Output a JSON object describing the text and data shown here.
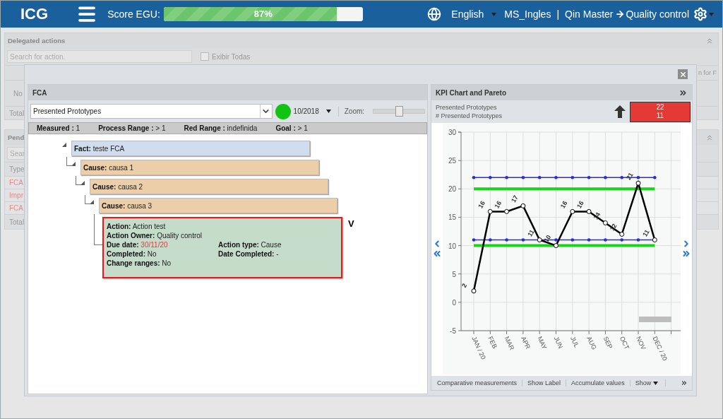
{
  "topbar": {
    "logo": "ICG",
    "score_label": "Score EGU:",
    "score": {
      "level": 0.87,
      "text": "87%"
    },
    "language": "English",
    "user": "MS_Ingles",
    "separator": "|",
    "path_from": "Qin Master",
    "path_to": "Quality control"
  },
  "background": {
    "delegated": {
      "title": "Delegated actions",
      "search_placeholder": "Search for action.",
      "checkbox": {
        "label": "Exibir Todas",
        "checked": false
      },
      "header_fragment": "n for F",
      "empty_fragment": "No",
      "total_fragment": "Total"
    },
    "pending": {
      "title": "Pend",
      "search_placeholder": "Sear",
      "header_fragment": "Type",
      "rows": [
        "FCA",
        "Impr",
        "FCA"
      ],
      "total_fragment": "Total"
    }
  },
  "fca": {
    "title": "FCA",
    "indicator": "Presented Prototypes",
    "period": "10/2018",
    "zoom_label": "Zoom:",
    "zoom": {
      "level": 0.5
    },
    "stats": [
      {
        "label": "Measured :",
        "value": "1"
      },
      {
        "label": "Process Range :",
        "value": "> 1"
      },
      {
        "label": "Red Range :",
        "value": "indefinida"
      },
      {
        "label": "Goal :",
        "value": "> 1"
      }
    ],
    "tree": {
      "kind": "fact",
      "label": "Fact:",
      "text": "teste FCA",
      "children": [
        {
          "kind": "cause",
          "label": "Cause:",
          "text": "causa 1",
          "children": [
            {
              "kind": "cause",
              "label": "Cause:",
              "text": "causa 2",
              "children": [
                {
                  "kind": "cause",
                  "label": "Cause:",
                  "text": "causa 3",
                  "children": [
                    {
                      "kind": "action",
                      "marker": "V",
                      "rows": [
                        {
                          "fields": [
                            {
                              "label": "Action:",
                              "value": "Action test",
                              "overdue": false
                            }
                          ]
                        },
                        {
                          "fields": [
                            {
                              "label": "Action Owner:",
                              "value": "Quality control",
                              "overdue": false
                            }
                          ]
                        },
                        {
                          "fields": [
                            {
                              "label": "Due date:",
                              "value": "30/11/20",
                              "overdue": true
                            },
                            {
                              "label": "Action type:",
                              "value": "Cause",
                              "overdue": false
                            }
                          ]
                        },
                        {
                          "fields": [
                            {
                              "label": "Completed:",
                              "value": "No",
                              "overdue": false
                            },
                            {
                              "label": "Date Completed:",
                              "value": "-",
                              "overdue": false
                            }
                          ]
                        },
                        {
                          "fields": [
                            {
                              "label": "Change ranges:",
                              "value": "No",
                              "overdue": false
                            }
                          ]
                        }
                      ]
                    }
                  ]
                }
              ]
            }
          ]
        }
      ]
    }
  },
  "kpi": {
    "title": "KPI Chart and Pareto",
    "subtitle": "Presented Prototypes",
    "unit": "# Presented Prototypes",
    "targets": [
      "22",
      "11"
    ],
    "chart_data": {
      "type": "line",
      "categories": [
        "JAN / 20",
        "FEB",
        "MAR",
        "APR",
        "MAY",
        "JUN",
        "JUL",
        "AUG",
        "SEP",
        "OCT",
        "NOV",
        "DEC / 20"
      ],
      "series": [
        {
          "color": "#000000",
          "marker": "circle",
          "values": [
            2,
            16,
            16,
            17,
            11,
            10,
            16,
            16,
            14,
            12,
            21,
            11
          ]
        },
        {
          "color": "#2b2bd9",
          "values": [
            22,
            22,
            22,
            22,
            22,
            22,
            22,
            22,
            22,
            22,
            22,
            22
          ]
        },
        {
          "color": "#2b2bd9",
          "values": [
            11,
            11,
            11,
            11,
            11,
            11,
            11,
            11,
            11,
            11,
            11,
            11
          ]
        },
        {
          "color": "#19d419",
          "values": [
            20,
            20,
            20,
            20,
            20,
            20,
            20,
            20,
            20,
            20,
            20,
            20
          ]
        },
        {
          "color": "#19d419",
          "values": [
            10,
            10,
            10,
            10,
            10,
            10,
            10,
            10,
            10,
            10,
            10,
            10
          ]
        }
      ],
      "value_labels": [
        "2",
        "16",
        "16",
        "17",
        "11",
        "10",
        "16",
        "16",
        "14",
        "12",
        "21",
        "11"
      ],
      "ylim": [
        -5,
        30
      ],
      "yticks": [
        -5,
        0,
        5,
        10,
        15,
        20,
        25,
        30
      ],
      "grid": true
    },
    "footer": [
      {
        "kind": "button",
        "label": "Comparative measurements"
      },
      {
        "kind": "button",
        "label": "Show Label"
      },
      {
        "kind": "button",
        "label": "Accumulate values"
      },
      {
        "kind": "dropdown",
        "label": "Show"
      }
    ]
  }
}
